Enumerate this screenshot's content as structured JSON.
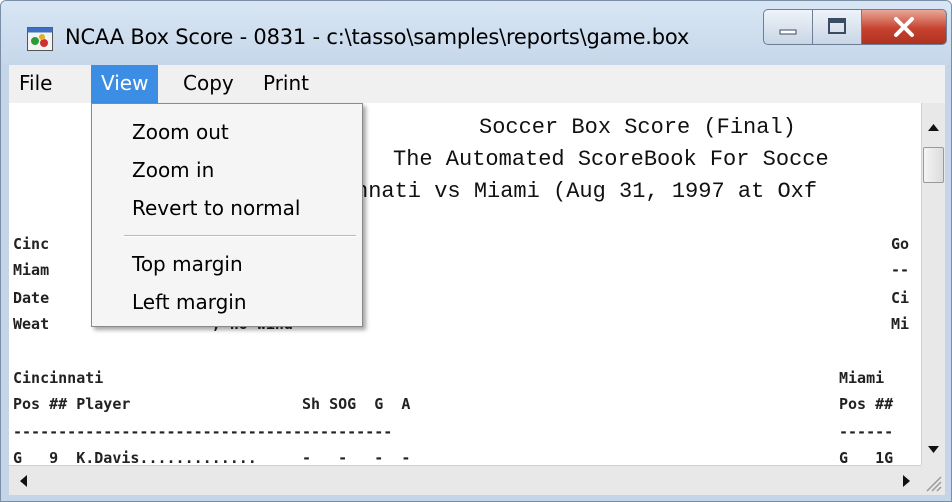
{
  "window": {
    "title": "NCAA Box Score - 0831 - c:\\tasso\\samples\\reports\\game.box"
  },
  "menubar": {
    "items": [
      "File",
      "View",
      "Copy",
      "Print"
    ],
    "active": "View"
  },
  "view_menu": {
    "items": [
      "Zoom out",
      "Zoom in",
      "Revert to normal",
      "Top margin",
      "Left margin"
    ]
  },
  "document": {
    "title_lines": [
      "Soccer Box Score (Final)",
      "The Automated ScoreBook For Socce",
      "nnati vs Miami (Aug 31, 1997 at Oxf"
    ],
    "left_lines": [
      "Cinc",
      "Miam",
      "Date                   endance: 304",
      "Weat                  , no wind",
      "",
      "Cincinnati",
      "Pos ## Player                   Sh SOG  G  A",
      "------------------------------------------",
      "G   9  K.Davis.............     -   -   -  -"
    ],
    "right_lines": [
      "Go",
      "--",
      "Ci",
      "Mi",
      "",
      "Miami",
      "Pos ##",
      "------",
      "G   1G"
    ]
  },
  "colors": {
    "menu_highlight": "#3b8ee4",
    "close_button": "#c6422f",
    "title_bar": "#c6d7ea"
  }
}
